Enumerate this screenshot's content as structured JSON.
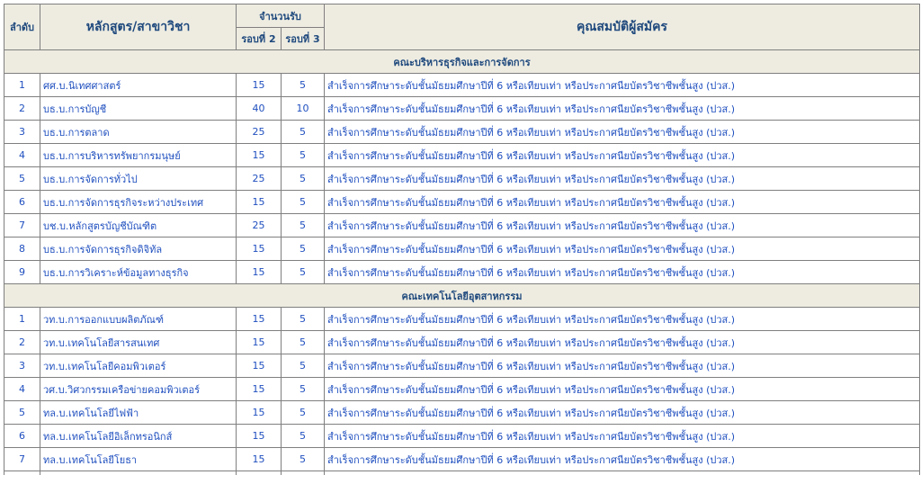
{
  "header": {
    "order": "ลำดับ",
    "program": "หลักสูตร/สาขาวิชา",
    "quota": "จำนวนรับ",
    "round2": "รอบที่ 2",
    "round3": "รอบที่ 3",
    "qualification": "คุณสมบัติผู้สมัคร"
  },
  "sections": [
    {
      "title": "คณะบริหารธุรกิจและการจัดการ",
      "rows": [
        {
          "no": "1",
          "program": "ศศ.บ.นิเทศศาสตร์",
          "r2": "15",
          "r3": "5",
          "qual": "สำเร็จการศึกษาระดับชั้นมัธยมศึกษาปีที่ 6 หรือเทียบเท่า  หรือประกาศนียบัตรวิชาชีพชั้นสูง (ปวส.)"
        },
        {
          "no": "2",
          "program": "บธ.บ.การบัญชี",
          "r2": "40",
          "r3": "10",
          "qual": "สำเร็จการศึกษาระดับชั้นมัธยมศึกษาปีที่ 6 หรือเทียบเท่า  หรือประกาศนียบัตรวิชาชีพชั้นสูง (ปวส.)"
        },
        {
          "no": "3",
          "program": "บธ.บ.การตลาด",
          "r2": "25",
          "r3": "5",
          "qual": "สำเร็จการศึกษาระดับชั้นมัธยมศึกษาปีที่ 6 หรือเทียบเท่า  หรือประกาศนียบัตรวิชาชีพชั้นสูง (ปวส.)"
        },
        {
          "no": "4",
          "program": "บธ.บ.การบริหารทรัพยากรมนุษย์",
          "r2": "15",
          "r3": "5",
          "qual": "สำเร็จการศึกษาระดับชั้นมัธยมศึกษาปีที่ 6 หรือเทียบเท่า  หรือประกาศนียบัตรวิชาชีพชั้นสูง (ปวส.)"
        },
        {
          "no": "5",
          "program": "บธ.บ.การจัดการทั่วไป",
          "r2": "25",
          "r3": "5",
          "qual": "สำเร็จการศึกษาระดับชั้นมัธยมศึกษาปีที่ 6 หรือเทียบเท่า  หรือประกาศนียบัตรวิชาชีพชั้นสูง (ปวส.)"
        },
        {
          "no": "6",
          "program": "บธ.บ.การจัดการธุรกิจระหว่างประเทศ",
          "r2": "15",
          "r3": "5",
          "qual": "สำเร็จการศึกษาระดับชั้นมัธยมศึกษาปีที่ 6 หรือเทียบเท่า  หรือประกาศนียบัตรวิชาชีพชั้นสูง (ปวส.)"
        },
        {
          "no": "7",
          "program": "บช.บ.หลักสูตรบัญชีบัณฑิต",
          "r2": "25",
          "r3": "5",
          "qual": "สำเร็จการศึกษาระดับชั้นมัธยมศึกษาปีที่ 6 หรือเทียบเท่า  หรือประกาศนียบัตรวิชาชีพชั้นสูง (ปวส.)"
        },
        {
          "no": "8",
          "program": "บธ.บ.การจัดการธุรกิจดิจิทัล",
          "r2": "15",
          "r3": "5",
          "qual": "สำเร็จการศึกษาระดับชั้นมัธยมศึกษาปีที่ 6 หรือเทียบเท่า  หรือประกาศนียบัตรวิชาชีพชั้นสูง (ปวส.)"
        },
        {
          "no": "9",
          "program": "บธ.บ.การวิเคราะห์ข้อมูลทางธุรกิจ",
          "r2": "15",
          "r3": "5",
          "qual": "สำเร็จการศึกษาระดับชั้นมัธยมศึกษาปีที่ 6 หรือเทียบเท่า  หรือประกาศนียบัตรวิชาชีพชั้นสูง (ปวส.)"
        }
      ]
    },
    {
      "title": "คณะเทคโนโลยีอุตสาหกรรม",
      "rows": [
        {
          "no": "1",
          "program": "วท.บ.การออกแบบผลิตภัณฑ์",
          "r2": "15",
          "r3": "5",
          "qual": "สำเร็จการศึกษาระดับชั้นมัธยมศึกษาปีที่ 6 หรือเทียบเท่า  หรือประกาศนียบัตรวิชาชีพชั้นสูง (ปวส.)"
        },
        {
          "no": "2",
          "program": "วท.บ.เทคโนโลยีสารสนเทศ",
          "r2": "15",
          "r3": "5",
          "qual": "สำเร็จการศึกษาระดับชั้นมัธยมศึกษาปีที่ 6 หรือเทียบเท่า  หรือประกาศนียบัตรวิชาชีพชั้นสูง (ปวส.)"
        },
        {
          "no": "3",
          "program": "วท.บ.เทคโนโลยีคอมพิวเตอร์",
          "r2": "15",
          "r3": "5",
          "qual": "สำเร็จการศึกษาระดับชั้นมัธยมศึกษาปีที่ 6 หรือเทียบเท่า  หรือประกาศนียบัตรวิชาชีพชั้นสูง (ปวส.)"
        },
        {
          "no": "4",
          "program": "วศ.บ.วิศวกรรมเครือข่ายคอมพิวเตอร์",
          "r2": "15",
          "r3": "5",
          "qual": "สำเร็จการศึกษาระดับชั้นมัธยมศึกษาปีที่ 6 หรือเทียบเท่า  หรือประกาศนียบัตรวิชาชีพชั้นสูง (ปวส.)"
        },
        {
          "no": "5",
          "program": "ทล.บ.เทคโนโลยีไฟฟ้า",
          "r2": "15",
          "r3": "5",
          "qual": "สำเร็จการศึกษาระดับชั้นมัธยมศึกษาปีที่ 6 หรือเทียบเท่า  หรือประกาศนียบัตรวิชาชีพชั้นสูง (ปวส.)"
        },
        {
          "no": "6",
          "program": "ทล.บ.เทคโนโลยีอิเล็กทรอนิกส์",
          "r2": "15",
          "r3": "5",
          "qual": "สำเร็จการศึกษาระดับชั้นมัธยมศึกษาปีที่ 6 หรือเทียบเท่า  หรือประกาศนียบัตรวิชาชีพชั้นสูง (ปวส.)"
        },
        {
          "no": "7",
          "program": "ทล.บ.เทคโนโลยีโยธา",
          "r2": "15",
          "r3": "5",
          "qual": "สำเร็จการศึกษาระดับชั้นมัธยมศึกษาปีที่ 6 หรือเทียบเท่า  หรือประกาศนียบัตรวิชาชีพชั้นสูง (ปวส.)"
        }
      ]
    }
  ]
}
